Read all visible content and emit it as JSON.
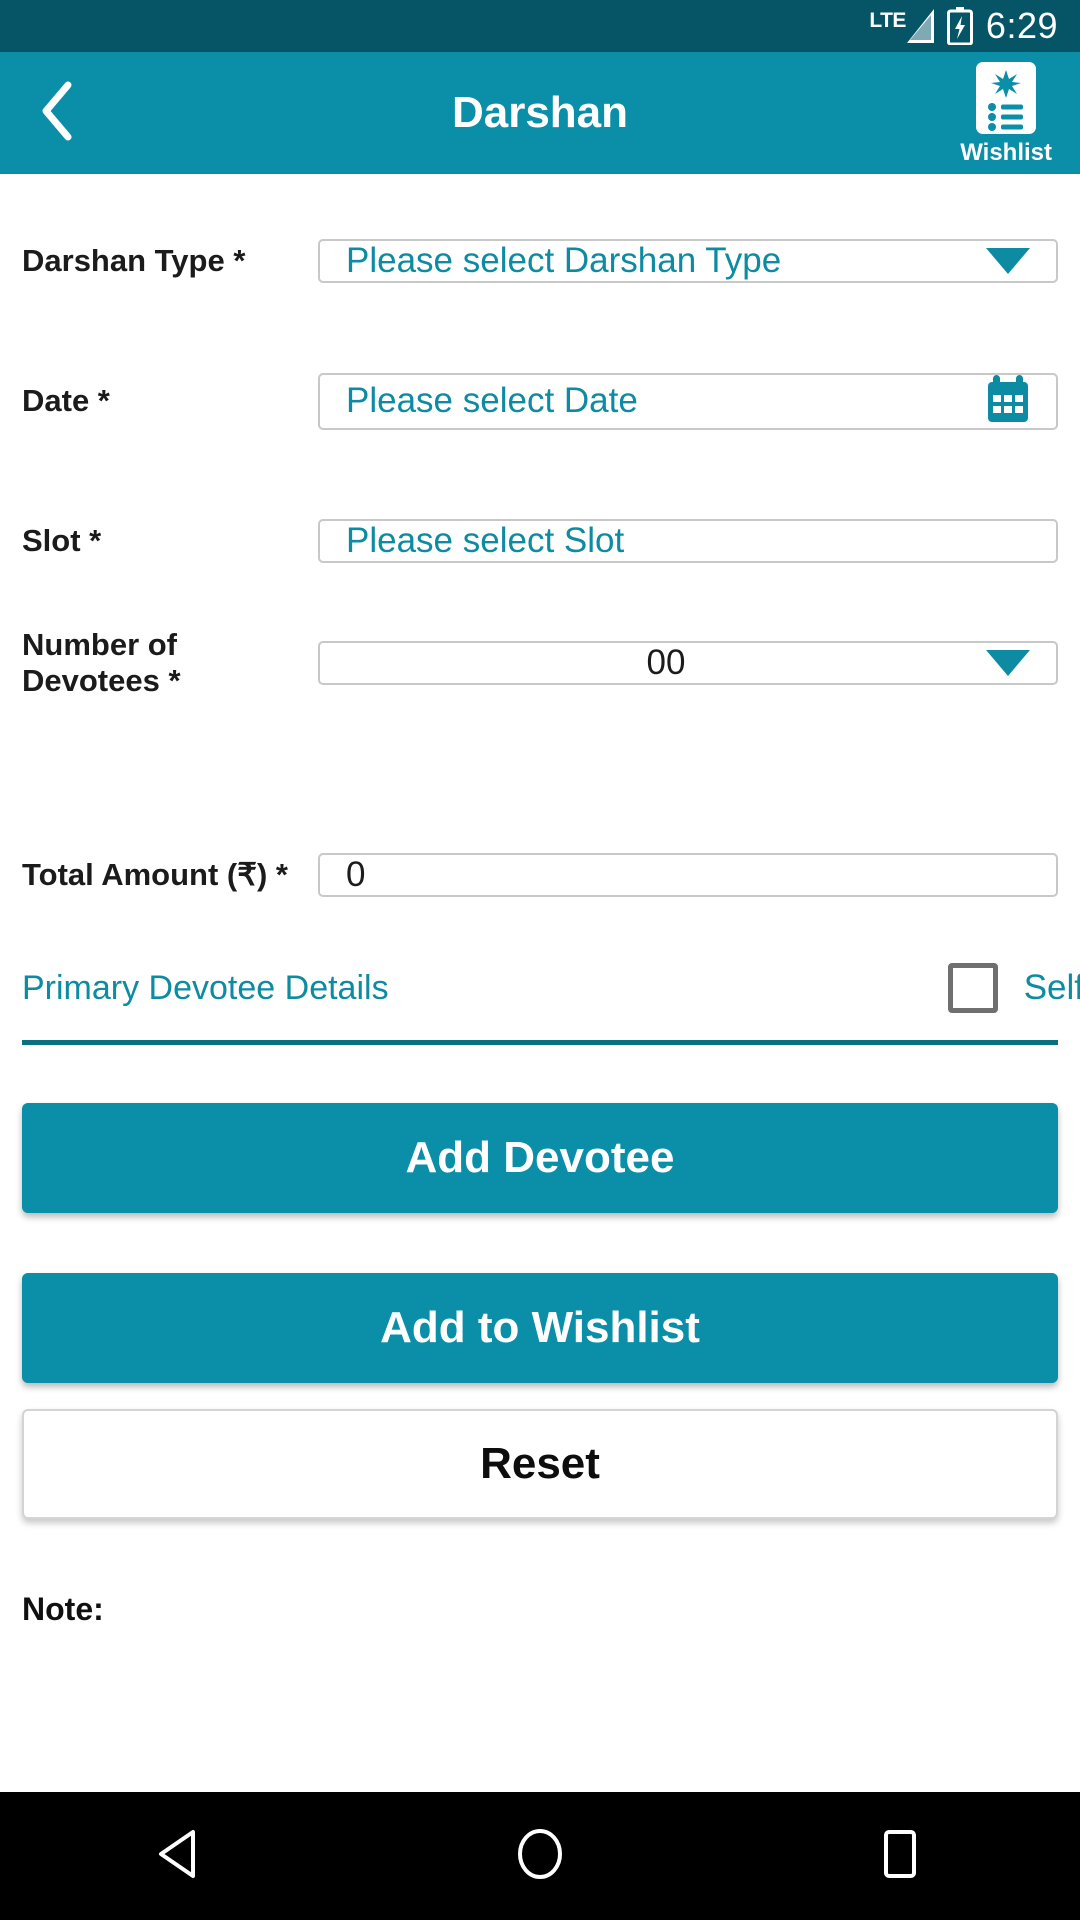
{
  "status_bar": {
    "network_label": "LTE",
    "time": "6:29",
    "icons": [
      "signal-icon",
      "battery-charging-icon"
    ]
  },
  "app_bar": {
    "back_icon": "chevron-left-icon",
    "title": "Darshan",
    "wishlist_label": "Wishlist",
    "wishlist_icon": "wishlist-document-icon"
  },
  "form": {
    "fields": [
      {
        "label": "Darshan Type *",
        "value": "Please select Darshan Type",
        "placeholder": "Please select Darshan Type",
        "control": "dropdown"
      },
      {
        "label": "Date *",
        "value": "Please select Date",
        "placeholder": "Please select Date",
        "control": "date-picker"
      },
      {
        "label": "Slot *",
        "value": "Please select Slot",
        "placeholder": "Please select Slot",
        "control": "text"
      },
      {
        "label": "Number of Devotees *",
        "value": "00",
        "placeholder": "00",
        "control": "dropdown"
      },
      {
        "label": "Total Amount (₹) *",
        "value": "0",
        "placeholder": "0",
        "control": "text"
      }
    ]
  },
  "primary_devotee": {
    "title": "Primary Devotee Details",
    "self_label": "Self",
    "self_checked": false
  },
  "actions": {
    "add_devotee": "Add Devotee",
    "add_to_wishlist": "Add to Wishlist",
    "reset": "Reset"
  },
  "note": {
    "label": "Note:"
  },
  "nav_bar": {
    "back": "back-triangle-icon",
    "home": "home-circle-icon",
    "recents": "recents-square-icon"
  },
  "colors": {
    "status_bar": "#065567",
    "app_bar": "#0b8fa8",
    "accent": "#0d8ba3",
    "divider": "#0c6f80",
    "text": "#1b1b1b"
  }
}
